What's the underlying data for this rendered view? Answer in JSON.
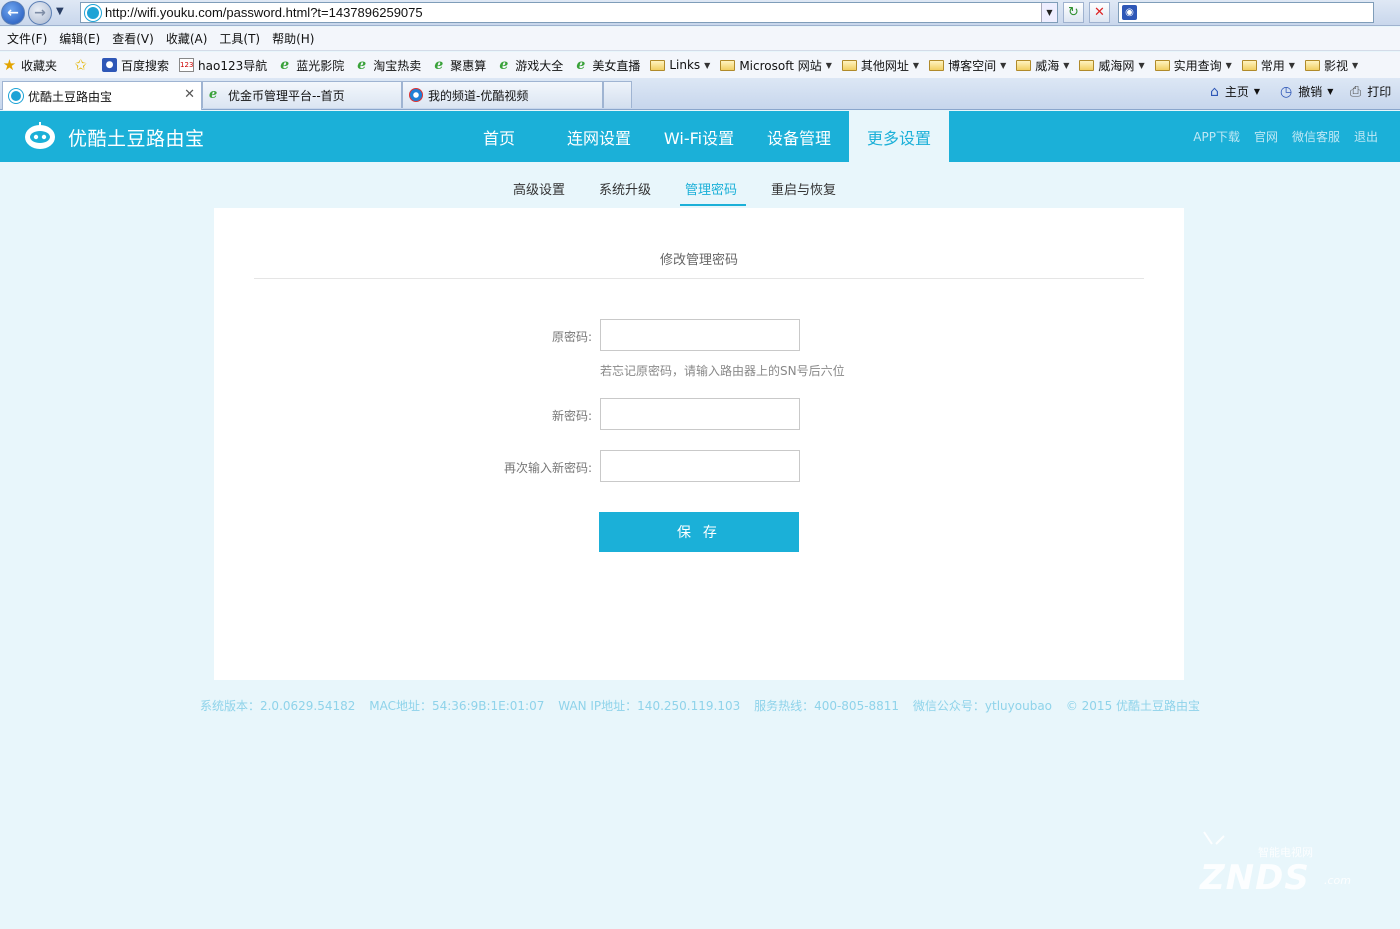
{
  "browser": {
    "url": "http://wifi.youku.com/password.html?t=1437896259075",
    "search_value": "",
    "menu": [
      "文件(F)",
      "编辑(E)",
      "查看(V)",
      "收藏(A)",
      "工具(T)",
      "帮助(H)"
    ],
    "favorites": [
      {
        "label": "收藏夹",
        "icon": "star-icon"
      },
      {
        "label": "百度搜索",
        "icon": "baidu-paw-icon"
      },
      {
        "label": "hao123导航",
        "icon": "hao123-icon"
      },
      {
        "label": "蓝光影院",
        "icon": "ie-page-icon"
      },
      {
        "label": "淘宝热卖",
        "icon": "ie-page-icon"
      },
      {
        "label": "聚惠算",
        "icon": "ie-page-icon"
      },
      {
        "label": "游戏大全",
        "icon": "ie-page-icon"
      },
      {
        "label": "美女直播",
        "icon": "ie-page-icon"
      },
      {
        "label": "Links",
        "icon": "folder-icon"
      },
      {
        "label": "Microsoft 网站",
        "icon": "folder-icon"
      },
      {
        "label": "其他网址",
        "icon": "folder-icon"
      },
      {
        "label": "博客空间",
        "icon": "folder-icon"
      },
      {
        "label": "威海",
        "icon": "folder-icon"
      },
      {
        "label": "威海网",
        "icon": "folder-icon"
      },
      {
        "label": "实用查询",
        "icon": "folder-icon"
      },
      {
        "label": "常用",
        "icon": "folder-icon"
      },
      {
        "label": "影视",
        "icon": "folder-icon"
      }
    ],
    "tabs": [
      {
        "label": "优酷土豆路由宝",
        "active": true
      },
      {
        "label": "优金币管理平台--首页",
        "active": false
      },
      {
        "label": "我的频道-优酷视频",
        "active": false
      }
    ],
    "commands": {
      "home": "主页",
      "undo": "撤销",
      "print": "打印"
    }
  },
  "app": {
    "logo_text": "优酷土豆路由宝",
    "nav": [
      "首页",
      "连网设置",
      "Wi-Fi设置",
      "设备管理",
      "更多设置"
    ],
    "nav_active": "更多设置",
    "util_links": [
      "APP下载",
      "官网",
      "微信客服",
      "退出"
    ],
    "sub_nav": [
      "高级设置",
      "系统升级",
      "管理密码",
      "重启与恢复"
    ],
    "sub_nav_active": "管理密码",
    "panel": {
      "title": "修改管理密码",
      "old_password_label": "原密码:",
      "old_password_value": "",
      "hint": "若忘记原密码，请输入路由器上的SN号后六位",
      "new_password_label": "新密码:",
      "new_password_value": "",
      "confirm_password_label": "再次输入新密码:",
      "confirm_password_value": "",
      "save_label": "保 存"
    },
    "footer": [
      "系统版本：2.0.0629.54182",
      "MAC地址：54:36:9B:1E:01:07",
      "WAN IP地址：140.250.119.103",
      "服务热线：400-805-8811",
      "微信公众号：ytluyoubao",
      "© 2015 优酷土豆路由宝"
    ]
  },
  "watermark": {
    "main": "ZNDS",
    "sub": "智能电视网",
    "com": ".com"
  },
  "colors": {
    "brand": "#1bb0d8",
    "page_bg": "#e8f6fb",
    "panel_bg": "#ffffff"
  }
}
